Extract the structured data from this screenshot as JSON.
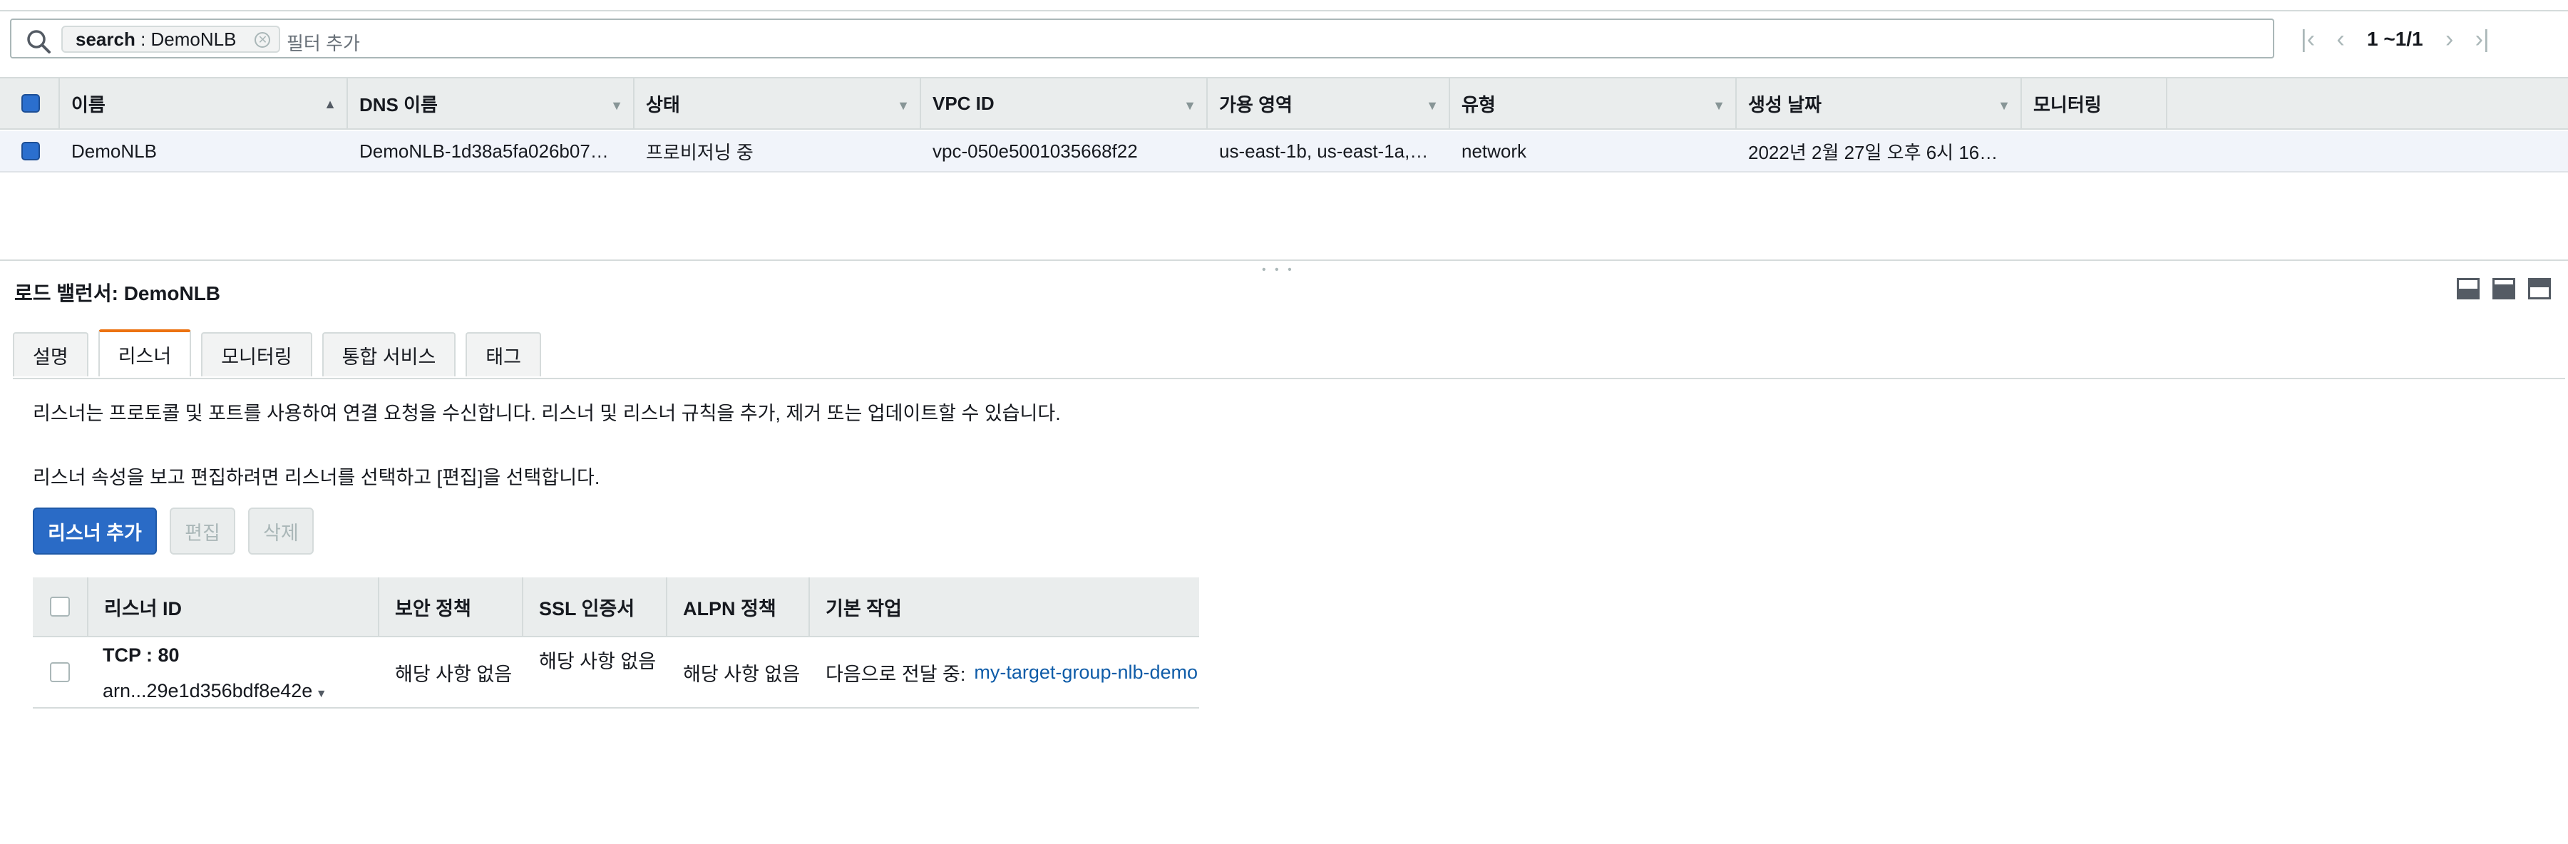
{
  "search": {
    "token_key": "search",
    "token_sep": " : ",
    "token_value": "DemoNLB",
    "placeholder": "필터 추가"
  },
  "pager": {
    "text": "1 ~1/1"
  },
  "table": {
    "columns": [
      "이름",
      "DNS 이름",
      "상태",
      "VPC ID",
      "가용 영역",
      "유형",
      "생성 날짜",
      "모니터링"
    ],
    "row": {
      "name": "DemoNLB",
      "dns": "DemoNLB-1d38a5fa026b07…",
      "state": "프로비저닝 중",
      "vpc": "vpc-050e5001035668f22",
      "az": "us-east-1b, us-east-1a,…",
      "type": "network",
      "created": "2022년 2월 27일 오후 6시 16…",
      "monitoring": ""
    }
  },
  "detail": {
    "title_prefix": "로드 밸런서:",
    "title_name": "DemoNLB",
    "tabs": [
      "설명",
      "리스너",
      "모니터링",
      "통합 서비스",
      "태그"
    ],
    "active_tab": "리스너",
    "desc1": "리스너는 프로토콜 및 포트를 사용하여 연결 요청을 수신합니다. 리스너 및 리스너 규칙을 추가, 제거 또는 업데이트할 수 있습니다.",
    "desc2": "리스너 속성을 보고 편집하려면 리스너를 선택하고 [편집]을 선택합니다.",
    "buttons": {
      "add": "리스너 추가",
      "edit": "편집",
      "delete": "삭제"
    }
  },
  "listeners": {
    "columns": [
      "리스너 ID",
      "보안 정책",
      "SSL 인증서",
      "ALPN 정책",
      "기본 작업"
    ],
    "row": {
      "protocol": "TCP : 80",
      "arn": "arn...29e1d356bdf8e42e",
      "security_policy": "해당 사항 없음",
      "ssl_cert": "해당 사항 없음",
      "alpn": "해당 사항 없음",
      "action_prefix": "다음으로 전달 중:",
      "action_target": "my-target-group-nlb-demo"
    }
  },
  "colors": {
    "accent": "#2a6bc6",
    "active_tab": "#ec7211",
    "link": "#0f5ca8",
    "row_selected": "#f1f4fa"
  }
}
